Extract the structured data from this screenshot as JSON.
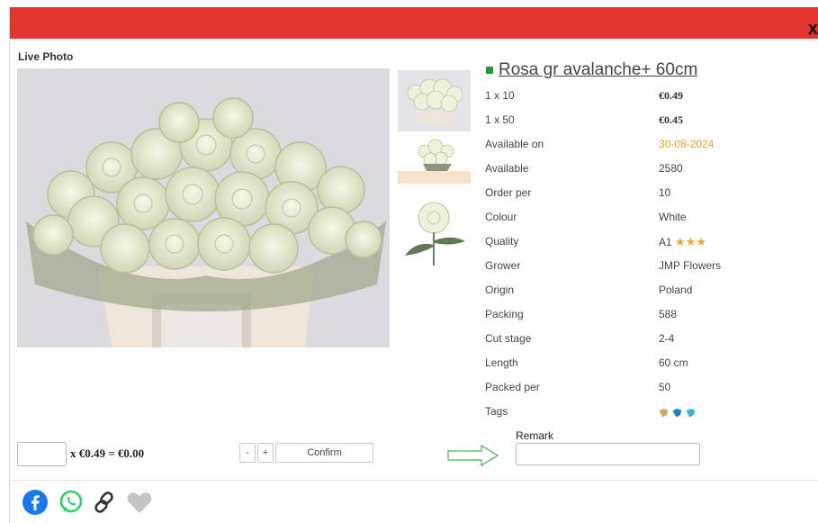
{
  "header": {
    "color": "#e2352d",
    "close_symbol": "x"
  },
  "photo": {
    "label": "Live Photo"
  },
  "product": {
    "title": "Rosa gr avalanche+ 60cm",
    "specs": [
      {
        "label": "1 x 10",
        "value": "€0.49",
        "style": "bold"
      },
      {
        "label": "1 x 50",
        "value": "€0.45",
        "style": "bold"
      },
      {
        "label": "Available on",
        "value": "30-08-2024",
        "style": "orange"
      },
      {
        "label": "Available",
        "value": "2580"
      },
      {
        "label": "Order per",
        "value": "10"
      },
      {
        "label": "Colour",
        "value": "White"
      },
      {
        "label": "Quality",
        "value": "A1",
        "stars": 3
      },
      {
        "label": "Grower",
        "value": "JMP Flowers"
      },
      {
        "label": "Origin",
        "value": "Poland"
      },
      {
        "label": "Packing",
        "value": "588"
      },
      {
        "label": "Cut stage",
        "value": "2-4"
      },
      {
        "label": "Length",
        "value": "60 cm"
      },
      {
        "label": "Packed per",
        "value": "50"
      },
      {
        "label": "Tags",
        "value": ""
      }
    ],
    "tags_colors": [
      "#d2a85a",
      "#1e7fb8",
      "#3bb6d6"
    ]
  },
  "order": {
    "quantity_value": "",
    "formula": "x €0.49 = €0.00",
    "minus_label": "-",
    "plus_label": "+",
    "confirm_label": "Confirm",
    "remark_label": "Remark",
    "remark_value": ""
  },
  "social": {
    "icons": [
      "facebook-icon",
      "whatsapp-icon",
      "link-icon",
      "heart-icon"
    ]
  }
}
